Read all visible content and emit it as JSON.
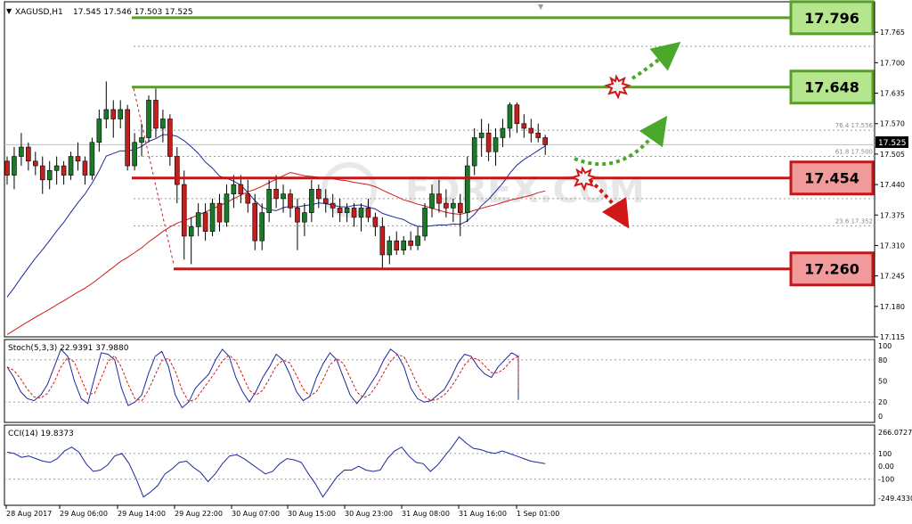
{
  "header": {
    "symbol": "XAGUSD,H1",
    "ohlc": "17.545 17.546 17.503 17.525"
  },
  "watermark": "FOREX.COM",
  "current_price_tag": "17.525",
  "levels": [
    {
      "value": 17.796,
      "label": "17.796",
      "color": "#5a9e2a",
      "fill": "#b5e58c"
    },
    {
      "value": 17.648,
      "label": "17.648",
      "color": "#5a9e2a",
      "fill": "#b5e58c"
    },
    {
      "value": 17.454,
      "label": "17.454",
      "color": "#c01818",
      "fill": "#f19a9c"
    },
    {
      "value": 17.26,
      "label": "17.260",
      "color": "#c01818",
      "fill": "#f19a9c"
    }
  ],
  "fib_labels": [
    {
      "value": 17.556,
      "label": "76.4   17.556"
    },
    {
      "value": 17.5,
      "label": "61.8   17.500"
    },
    {
      "value": 17.352,
      "label": "23.6   17.352"
    }
  ],
  "price_axis": {
    "min": 17.115,
    "max": 17.83,
    "ticks": [
      "17.765",
      "17.700",
      "17.635",
      "17.570",
      "17.505",
      "17.440",
      "17.375",
      "17.310",
      "17.245",
      "17.180",
      "17.115"
    ]
  },
  "time_axis": {
    "labels": [
      "28 Aug 2017",
      "29 Aug 06:00",
      "29 Aug 14:00",
      "29 Aug 22:00",
      "30 Aug 07:00",
      "30 Aug 15:00",
      "30 Aug 23:00",
      "31 Aug 08:00",
      "31 Aug 16:00",
      "1 Sep 01:00"
    ]
  },
  "stoch": {
    "label": "Stoch(5,3,3) 22.9391 37.9880",
    "ticks": [
      "100",
      "80",
      "50",
      "20",
      "0"
    ]
  },
  "cci": {
    "label": "CCI(14) 19.8373",
    "ticks": [
      "266.0727",
      "100",
      "0.00",
      "-100",
      "-249.4330"
    ]
  },
  "chart_data": {
    "type": "candlestick",
    "symbol": "XAGUSD",
    "timeframe": "H1",
    "candles": [
      [
        17.49,
        17.5,
        17.44,
        17.46
      ],
      [
        17.46,
        17.52,
        17.43,
        17.5
      ],
      [
        17.5,
        17.55,
        17.48,
        17.52
      ],
      [
        17.52,
        17.53,
        17.47,
        17.49
      ],
      [
        17.49,
        17.51,
        17.46,
        17.48
      ],
      [
        17.48,
        17.5,
        17.42,
        17.45
      ],
      [
        17.45,
        17.49,
        17.43,
        17.47
      ],
      [
        17.47,
        17.5,
        17.44,
        17.48
      ],
      [
        17.48,
        17.49,
        17.44,
        17.46
      ],
      [
        17.46,
        17.51,
        17.45,
        17.5
      ],
      [
        17.5,
        17.53,
        17.47,
        17.49
      ],
      [
        17.49,
        17.5,
        17.44,
        17.46
      ],
      [
        17.46,
        17.54,
        17.45,
        17.53
      ],
      [
        17.53,
        17.6,
        17.51,
        17.58
      ],
      [
        17.58,
        17.66,
        17.56,
        17.6
      ],
      [
        17.6,
        17.62,
        17.54,
        17.58
      ],
      [
        17.58,
        17.62,
        17.56,
        17.6
      ],
      [
        17.6,
        17.61,
        17.47,
        17.48
      ],
      [
        17.48,
        17.55,
        17.47,
        17.53
      ],
      [
        17.53,
        17.57,
        17.5,
        17.54
      ],
      [
        17.54,
        17.63,
        17.53,
        17.62
      ],
      [
        17.62,
        17.645,
        17.54,
        17.56
      ],
      [
        17.56,
        17.6,
        17.53,
        17.58
      ],
      [
        17.58,
        17.59,
        17.48,
        17.5
      ],
      [
        17.5,
        17.52,
        17.4,
        17.44
      ],
      [
        17.44,
        17.47,
        17.28,
        17.33
      ],
      [
        17.33,
        17.37,
        17.27,
        17.35
      ],
      [
        17.35,
        17.4,
        17.33,
        17.38
      ],
      [
        17.38,
        17.4,
        17.32,
        17.34
      ],
      [
        17.34,
        17.41,
        17.33,
        17.4
      ],
      [
        17.4,
        17.42,
        17.34,
        17.36
      ],
      [
        17.36,
        17.44,
        17.35,
        17.42
      ],
      [
        17.42,
        17.46,
        17.39,
        17.44
      ],
      [
        17.44,
        17.46,
        17.4,
        17.42
      ],
      [
        17.42,
        17.45,
        17.38,
        17.4
      ],
      [
        17.4,
        17.42,
        17.3,
        17.32
      ],
      [
        17.32,
        17.4,
        17.3,
        17.38
      ],
      [
        17.38,
        17.45,
        17.36,
        17.43
      ],
      [
        17.43,
        17.46,
        17.39,
        17.41
      ],
      [
        17.41,
        17.44,
        17.38,
        17.42
      ],
      [
        17.42,
        17.43,
        17.37,
        17.39
      ],
      [
        17.39,
        17.41,
        17.3,
        17.36
      ],
      [
        17.36,
        17.4,
        17.33,
        17.38
      ],
      [
        17.38,
        17.45,
        17.36,
        17.43
      ],
      [
        17.43,
        17.44,
        17.39,
        17.41
      ],
      [
        17.41,
        17.43,
        17.38,
        17.4
      ],
      [
        17.4,
        17.42,
        17.37,
        17.39
      ],
      [
        17.39,
        17.41,
        17.36,
        17.38
      ],
      [
        17.38,
        17.4,
        17.36,
        17.39
      ],
      [
        17.39,
        17.4,
        17.35,
        17.37
      ],
      [
        17.37,
        17.4,
        17.34,
        17.39
      ],
      [
        17.39,
        17.41,
        17.36,
        17.37
      ],
      [
        17.37,
        17.38,
        17.33,
        17.35
      ],
      [
        17.35,
        17.37,
        17.26,
        17.29
      ],
      [
        17.29,
        17.33,
        17.27,
        17.32
      ],
      [
        17.32,
        17.34,
        17.29,
        17.3
      ],
      [
        17.3,
        17.33,
        17.29,
        17.32
      ],
      [
        17.32,
        17.34,
        17.3,
        17.31
      ],
      [
        17.31,
        17.35,
        17.3,
        17.33
      ],
      [
        17.33,
        17.4,
        17.32,
        17.39
      ],
      [
        17.39,
        17.44,
        17.37,
        17.42
      ],
      [
        17.42,
        17.45,
        17.38,
        17.4
      ],
      [
        17.4,
        17.43,
        17.37,
        17.39
      ],
      [
        17.39,
        17.41,
        17.36,
        17.4
      ],
      [
        17.4,
        17.42,
        17.33,
        17.38
      ],
      [
        17.38,
        17.5,
        17.36,
        17.48
      ],
      [
        17.48,
        17.56,
        17.46,
        17.54
      ],
      [
        17.54,
        17.58,
        17.5,
        17.55
      ],
      [
        17.55,
        17.57,
        17.49,
        17.51
      ],
      [
        17.51,
        17.56,
        17.48,
        17.54
      ],
      [
        17.54,
        17.58,
        17.52,
        17.56
      ],
      [
        17.56,
        17.615,
        17.54,
        17.61
      ],
      [
        17.61,
        17.615,
        17.55,
        17.57
      ],
      [
        17.57,
        17.59,
        17.54,
        17.56
      ],
      [
        17.56,
        17.58,
        17.53,
        17.55
      ],
      [
        17.55,
        17.57,
        17.53,
        17.54
      ],
      [
        17.54,
        17.546,
        17.503,
        17.525
      ]
    ],
    "series": [
      {
        "name": "MA",
        "color": "#1c2a9c"
      },
      {
        "name": "MA",
        "color": "#d01c1c"
      }
    ],
    "ylim": [
      17.115,
      17.83
    ]
  }
}
